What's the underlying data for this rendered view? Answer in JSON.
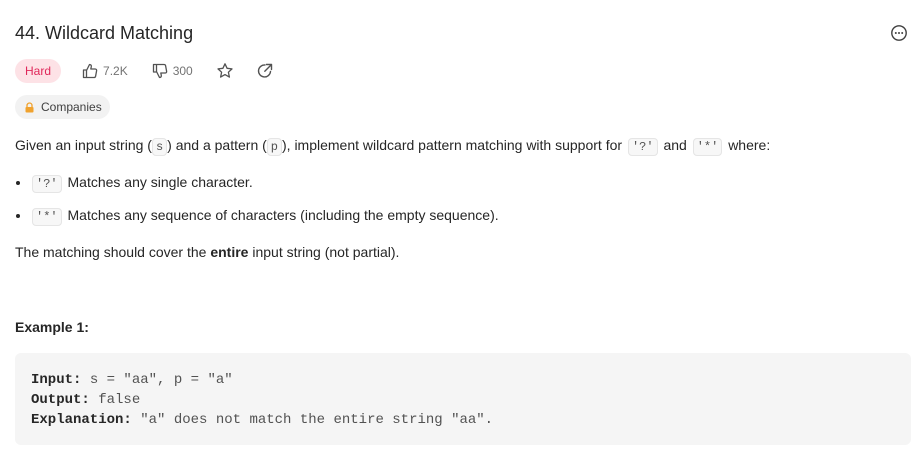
{
  "problem": {
    "title": "44. Wildcard Matching",
    "difficulty": "Hard",
    "likes": "7.2K",
    "dislikes": "300",
    "companies_label": "Companies"
  },
  "description": {
    "intro_1": "Given an input string (",
    "intro_code_s": "s",
    "intro_2": ") and a pattern (",
    "intro_code_p": "p",
    "intro_3": "), implement wildcard pattern matching with support for",
    "intro_code_q": "'?'",
    "intro_4": "and",
    "intro_code_star": "'*'",
    "intro_5": "where:",
    "bullets": [
      {
        "code": "'?'",
        "text": "Matches any single character."
      },
      {
        "code": "'*'",
        "text": "Matches any sequence of characters (including the empty sequence)."
      }
    ],
    "coverage_1": "The matching should cover the ",
    "coverage_bold": "entire",
    "coverage_2": " input string (not partial)."
  },
  "example1": {
    "title": "Example 1:",
    "input_label": "Input:",
    "input_value": " s = \"aa\", p = \"a\"",
    "output_label": "Output:",
    "output_value": " false",
    "explanation_label": "Explanation:",
    "explanation_value": " \"a\" does not match the entire string \"aa\"."
  },
  "colors": {
    "hard_text": "#e0285a",
    "hard_bg": "#fde2e6",
    "lock": "#f0a22e"
  }
}
